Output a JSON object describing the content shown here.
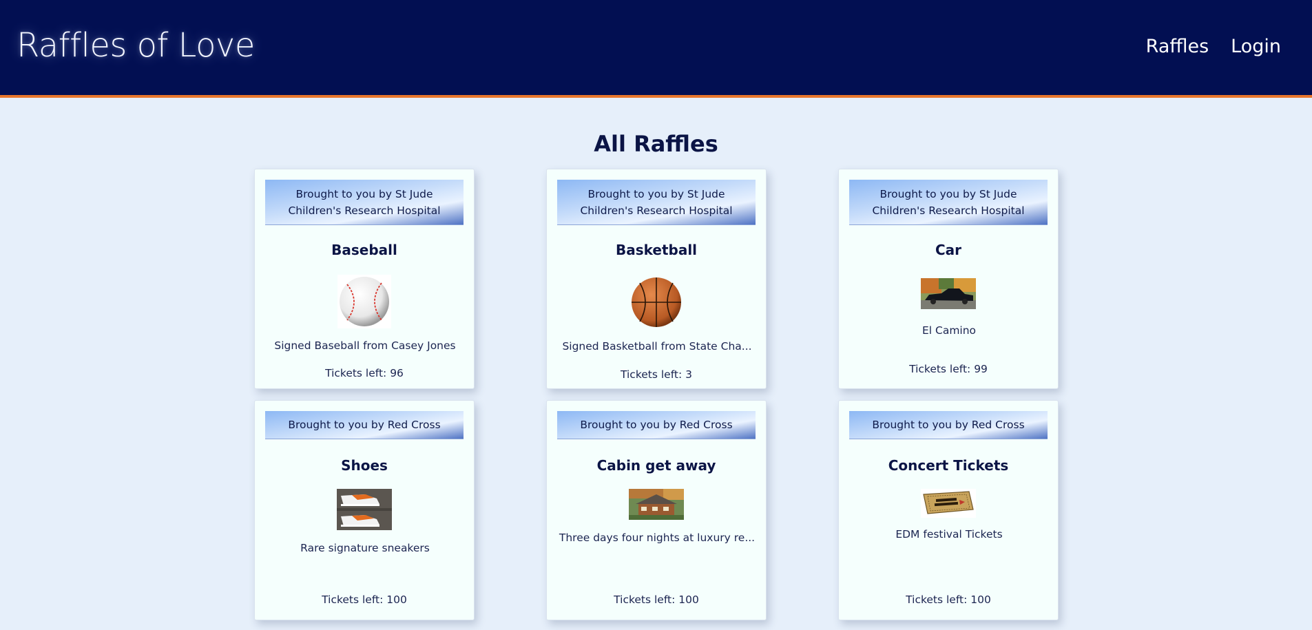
{
  "header": {
    "brand": "Raffles of Love",
    "nav": {
      "raffles": "Raffles",
      "login": "Login"
    }
  },
  "main": {
    "title": "All Raffles"
  },
  "raffles": [
    {
      "sponsor": "Brought to you by St Jude Children's Research Hospital",
      "title": "Baseball",
      "image": "baseball-photo",
      "description": "Signed Baseball from Casey Jones",
      "tickets": "Tickets left: 96"
    },
    {
      "sponsor": "Brought to you by St Jude Children's Research Hospital",
      "title": "Basketball",
      "image": "basketball-photo",
      "description": "Signed Basketball from State Cha...",
      "tickets": "Tickets left: 3"
    },
    {
      "sponsor": "Brought to you by St Jude Children's Research Hospital",
      "title": "Car",
      "image": "car-photo",
      "description": "El Camino",
      "tickets": "Tickets left: 99"
    },
    {
      "sponsor": "Brought to you by Red Cross",
      "title": "Shoes",
      "image": "sneakers-photo",
      "description": "Rare signature sneakers",
      "tickets": "Tickets left: 100"
    },
    {
      "sponsor": "Brought to you by Red Cross",
      "title": "Cabin get away",
      "image": "cabin-photo",
      "description": "Three days four nights at luxury re...",
      "tickets": "Tickets left: 100"
    },
    {
      "sponsor": "Brought to you by Red Cross",
      "title": "Concert Tickets",
      "image": "tickets-photo",
      "description": "EDM festival Tickets",
      "tickets": "Tickets left: 100"
    }
  ],
  "colors": {
    "header_bg": "#020f52",
    "header_border": "#e8762b",
    "page_bg": "#e6effa",
    "card_bg": "#f5fffd"
  }
}
